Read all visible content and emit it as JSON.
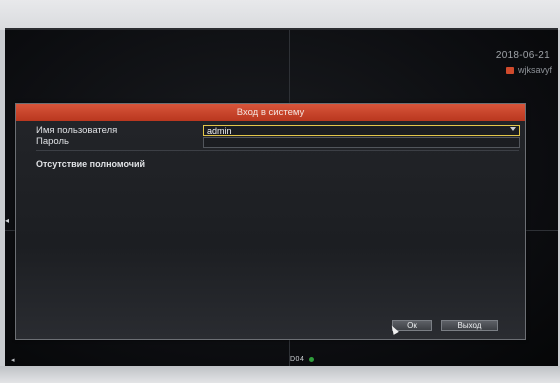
{
  "status": {
    "date": "2018-06-21",
    "network_label": "wjksavyf",
    "channel_label": "D04"
  },
  "dialog": {
    "title": "Вход в систему",
    "username_label": "Имя пользователя",
    "username_value": "admin",
    "password_label": "Пароль",
    "password_value": "",
    "notice": "Отсутствие полномочий",
    "ok_label": "Ок",
    "exit_label": "Выход"
  },
  "colors": {
    "title_bar": "#c8452a",
    "active_field_border": "#e3c64a",
    "status_ok": "#2f9e3c"
  },
  "icons": [
    "wifi-icon",
    "chevron-down-icon",
    "mouse-cursor-icon",
    "record-status-icon"
  ]
}
